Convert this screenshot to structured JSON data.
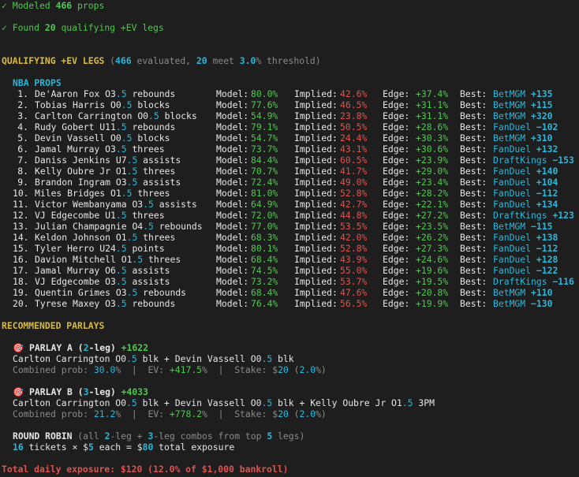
{
  "status": {
    "modeled": {
      "check": "✓",
      "pre": "Modeled ",
      "num": "466",
      "post": " props"
    },
    "found": {
      "check": "✓",
      "pre": "Found ",
      "num": "20",
      "post": " qualifying +EV legs"
    }
  },
  "qualifying": {
    "title": "QUALIFYING +EV LEGS",
    "evaluated": "466",
    "meet": "20",
    "threshold": "3.0",
    "t1": " (",
    "t2": " evaluated, ",
    "t3": " meet ",
    "t4": "% threshold)"
  },
  "nba_header": "NBA PROPS",
  "labels": {
    "model": "Model:",
    "implied": "Implied:",
    "edge": "Edge:",
    "best": "Best:"
  },
  "props": [
    {
      "n": "1.",
      "player": "De'Aaron Fox",
      "ou": "O3",
      "dec": ".5",
      "stat": "rebounds",
      "model": "80.0%",
      "implied": "42.6%",
      "edge": "+37.4%",
      "book": "BetMGM",
      "odds": "+135"
    },
    {
      "n": "2.",
      "player": "Tobias Harris",
      "ou": "O0",
      "dec": ".5",
      "stat": "blocks",
      "model": "77.6%",
      "implied": "46.5%",
      "edge": "+31.1%",
      "book": "BetMGM",
      "odds": "+115"
    },
    {
      "n": "3.",
      "player": "Carlton Carrington",
      "ou": "O0",
      "dec": ".5",
      "stat": "blocks",
      "model": "54.9%",
      "implied": "23.8%",
      "edge": "+31.1%",
      "book": "BetMGM",
      "odds": "+320"
    },
    {
      "n": "4.",
      "player": "Rudy Gobert",
      "ou": "U11",
      "dec": ".5",
      "stat": "rebounds",
      "model": "79.1%",
      "implied": "50.5%",
      "edge": "+28.6%",
      "book": "FanDuel",
      "odds": "−102"
    },
    {
      "n": "5.",
      "player": "Devin Vassell",
      "ou": "O0",
      "dec": ".5",
      "stat": "blocks",
      "model": "54.7%",
      "implied": "24.4%",
      "edge": "+30.3%",
      "book": "BetMGM",
      "odds": "+310"
    },
    {
      "n": "6.",
      "player": "Jamal Murray",
      "ou": "O3",
      "dec": ".5",
      "stat": "threes",
      "model": "73.7%",
      "implied": "43.1%",
      "edge": "+30.6%",
      "book": "FanDuel",
      "odds": "+132"
    },
    {
      "n": "7.",
      "player": "Daniss Jenkins",
      "ou": "U7",
      "dec": ".5",
      "stat": "assists",
      "model": "84.4%",
      "implied": "60.5%",
      "edge": "+23.9%",
      "book": "DraftKings",
      "odds": "−153"
    },
    {
      "n": "8.",
      "player": "Kelly Oubre Jr",
      "ou": "O1",
      "dec": ".5",
      "stat": "threes",
      "model": "70.7%",
      "implied": "41.7%",
      "edge": "+29.0%",
      "book": "FanDuel",
      "odds": "+140"
    },
    {
      "n": "9.",
      "player": "Brandon Ingram",
      "ou": "O3",
      "dec": ".5",
      "stat": "assists",
      "model": "72.4%",
      "implied": "49.0%",
      "edge": "+23.4%",
      "book": "FanDuel",
      "odds": "+104"
    },
    {
      "n": "10.",
      "player": "Miles Bridges",
      "ou": "O1",
      "dec": ".5",
      "stat": "threes",
      "model": "81.0%",
      "implied": "52.8%",
      "edge": "+28.2%",
      "book": "FanDuel",
      "odds": "−112"
    },
    {
      "n": "11.",
      "player": "Victor Wembanyama",
      "ou": "O3",
      "dec": ".5",
      "stat": "assists",
      "model": "64.9%",
      "implied": "42.7%",
      "edge": "+22.1%",
      "book": "FanDuel",
      "odds": "+134"
    },
    {
      "n": "12.",
      "player": "VJ Edgecombe",
      "ou": "U1",
      "dec": ".5",
      "stat": "threes",
      "model": "72.0%",
      "implied": "44.8%",
      "edge": "+27.2%",
      "book": "DraftKings",
      "odds": "+123"
    },
    {
      "n": "13.",
      "player": "Julian Champagnie",
      "ou": "O4",
      "dec": ".5",
      "stat": "rebounds",
      "model": "77.0%",
      "implied": "53.5%",
      "edge": "+23.5%",
      "book": "BetMGM",
      "odds": "−115"
    },
    {
      "n": "14.",
      "player": "Keldon Johnson",
      "ou": "O1",
      "dec": ".5",
      "stat": "threes",
      "model": "68.3%",
      "implied": "42.0%",
      "edge": "+26.2%",
      "book": "FanDuel",
      "odds": "+138"
    },
    {
      "n": "15.",
      "player": "Tyler Herro",
      "ou": "U24",
      "dec": ".5",
      "stat": "points",
      "model": "80.1%",
      "implied": "52.8%",
      "edge": "+27.3%",
      "book": "FanDuel",
      "odds": "−112"
    },
    {
      "n": "16.",
      "player": "Davion Mitchell",
      "ou": "O1",
      "dec": ".5",
      "stat": "threes",
      "model": "68.4%",
      "implied": "43.9%",
      "edge": "+24.6%",
      "book": "FanDuel",
      "odds": "+128"
    },
    {
      "n": "17.",
      "player": "Jamal Murray",
      "ou": "O6",
      "dec": ".5",
      "stat": "assists",
      "model": "74.5%",
      "implied": "55.0%",
      "edge": "+19.6%",
      "book": "FanDuel",
      "odds": "−122"
    },
    {
      "n": "18.",
      "player": "VJ Edgecombe",
      "ou": "O3",
      "dec": ".5",
      "stat": "assists",
      "model": "73.2%",
      "implied": "53.7%",
      "edge": "+19.5%",
      "book": "DraftKings",
      "odds": "−116"
    },
    {
      "n": "19.",
      "player": "Quentin Grimes",
      "ou": "O3",
      "dec": ".5",
      "stat": "rebounds",
      "model": "68.4%",
      "implied": "47.6%",
      "edge": "+20.8%",
      "book": "BetMGM",
      "odds": "+110"
    },
    {
      "n": "20.",
      "player": "Tyrese Maxey",
      "ou": "O3",
      "dec": ".5",
      "stat": "rebounds",
      "model": "76.4%",
      "implied": "56.5%",
      "edge": "+19.9%",
      "book": "BetMGM",
      "odds": "−130"
    }
  ],
  "recommended_title": "RECOMMENDED PARLAYS",
  "parlay_a": {
    "icon": "🎯",
    "name": "PARLAY A",
    "open": " (",
    "legs": "2",
    "legs_suffix": "-leg)",
    "odds": "+1622",
    "l1": "Carlton Carrington O0",
    "l1d": ".5",
    "l1s": " blk + Devin Vassell O0",
    "l2d": ".5",
    "l2s": " blk",
    "prob_label": "Combined prob: ",
    "prob": "30.0",
    "ev_label": "%  |  EV: ",
    "ev": "+417.5",
    "stake_label": "%  |  Stake: ",
    "stake_cur": "$",
    "stake": "20",
    "stake_pct": "2.0",
    "tail": "%)"
  },
  "parlay_b": {
    "icon": "🎯",
    "name": "PARLAY B",
    "open": " (",
    "legs": "3",
    "legs_suffix": "-leg)",
    "odds": "+4033",
    "l1": "Carlton Carrington O0",
    "l1d": ".5",
    "l1s": " blk + Devin Vassell O0",
    "l2d": ".5",
    "l2s": " blk + Kelly Oubre Jr O1",
    "l3d": ".5",
    "l3s": " 3PM",
    "prob_label": "Combined prob: ",
    "prob": "21.2",
    "ev_label": "%  |  EV: ",
    "ev": "+778.2",
    "stake_label": "%  |  Stake: ",
    "stake_cur": "$",
    "stake": "20",
    "stake_pct": "2.0",
    "tail": "%)"
  },
  "round_robin": {
    "title": "ROUND ROBIN",
    "d1": " (all ",
    "n1": "2",
    "d2": "-leg + ",
    "n2": "3",
    "d3": "-leg combos from top ",
    "n3": "5",
    "d4": " legs)",
    "tickets": "16",
    "t1": " tickets × ",
    "cur1": "$",
    "each": "5",
    "t2": " each = ",
    "cur2": "$",
    "total": "80",
    "t3": " total exposure"
  },
  "total_exposure": "Total daily exposure: $120 (12.0% of $1,000 bankroll)"
}
